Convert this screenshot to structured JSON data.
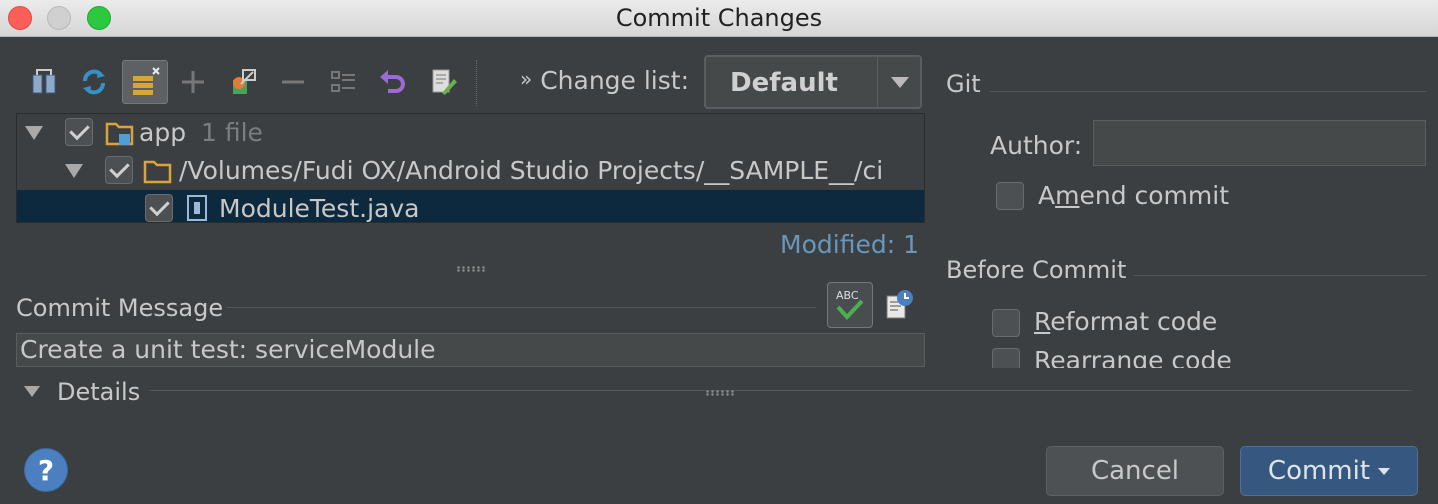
{
  "window": {
    "title": "Commit Changes"
  },
  "toolbar": {
    "icons": [
      "diff-icon",
      "refresh-icon",
      "group-by-icon",
      "add-icon",
      "move-icon",
      "remove-icon",
      "expand-all-icon",
      "revert-icon",
      "edit-source-icon"
    ],
    "change_list_label": "Change list:",
    "change_list_value": "Default"
  },
  "tree": {
    "rows": [
      {
        "label": "app",
        "extra": "1 file"
      },
      {
        "label": "/Volumes/Fudi OX/Android Studio Projects/__SAMPLE__/ci"
      },
      {
        "label": "ModuleTest.java"
      }
    ],
    "modified": "Modified: 1"
  },
  "commit_message": {
    "title": "Commit Message",
    "value": "Create a unit test: serviceModule"
  },
  "details": {
    "label": "Details"
  },
  "git": {
    "title": "Git",
    "author_label": "Author:",
    "author_value": "",
    "amend_label_pre": "A",
    "amend_label_ul": "m",
    "amend_label_post": "end commit"
  },
  "before_commit": {
    "title": "Before Commit",
    "reformat_ul": "R",
    "reformat_rest": "eformat code",
    "rearrange_ul": "R",
    "rearrange_rest": "earrange code"
  },
  "buttons": {
    "help": "?",
    "cancel": "Cancel",
    "commit": "Commit"
  },
  "colors": {
    "background": "#3c3f41",
    "selection": "#0d293e",
    "modified": "#6897bb",
    "commit_button": "#365880"
  }
}
